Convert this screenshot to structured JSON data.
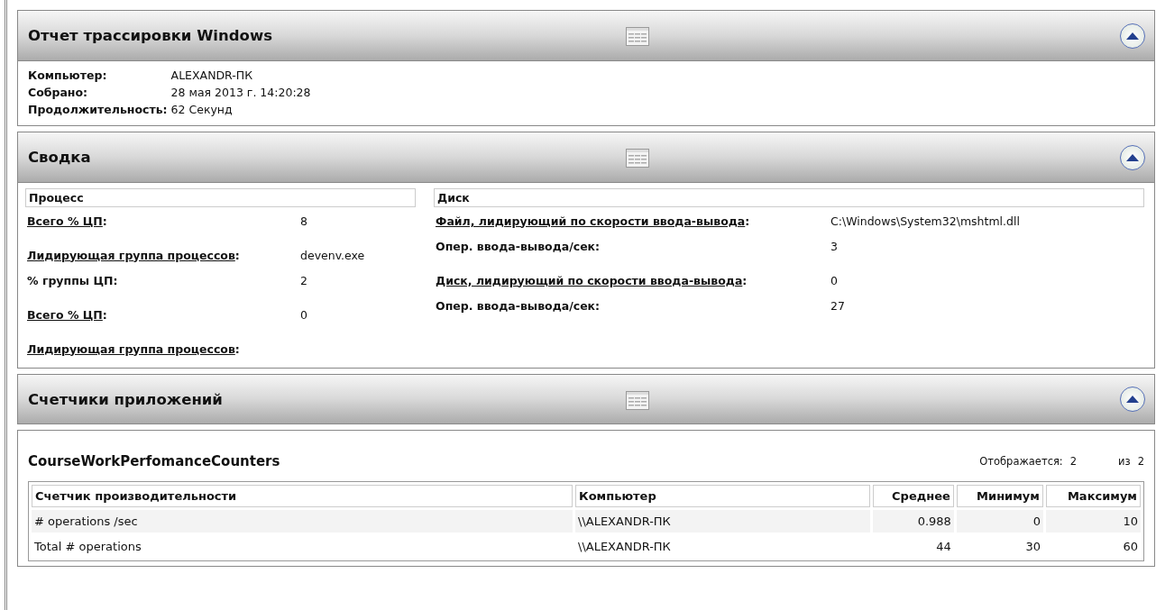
{
  "sections": [
    {
      "title": "Отчет трассировки Windows",
      "kind": "info",
      "info": [
        {
          "label": "Компьютер:",
          "value": "ALEXANDR-ПК"
        },
        {
          "label": "Собрано:",
          "value": "28 мая 2013 г. 14:20:28"
        },
        {
          "label": "Продолжительность:",
          "value": "62 Секунд"
        }
      ]
    },
    {
      "title": "Сводка",
      "kind": "summary",
      "columns": [
        {
          "title": "Процесс",
          "rows": [
            {
              "kind": "link",
              "label": "Всего % ЦП",
              "after": ":",
              "value": "8"
            },
            {
              "kind": "link",
              "label": "Лидирующая группа процессов",
              "after": ":",
              "value": "devenv.exe"
            },
            {
              "kind": "plain",
              "label": "% группы ЦП:",
              "value": "2"
            },
            {
              "kind": "link",
              "label": "Всего % ЦП",
              "after": ":",
              "value": "0"
            },
            {
              "kind": "link",
              "label": "Лидирующая группа процессов",
              "after": ":"
            }
          ]
        },
        {
          "title": "Диск",
          "rows": [
            {
              "kind": "link",
              "label": "Файл, лидирующий по скорости ввода-вывода",
              "after": ":",
              "value": "C:\\Windows\\System32\\mshtml.dll"
            },
            {
              "kind": "plain",
              "label": "Опер. ввода-вывода/сек:",
              "value": "3"
            },
            {
              "kind": "link",
              "label": "Диск, лидирующий по скорости ввода-вывода",
              "after": ":",
              "value": "0"
            },
            {
              "kind": "plain",
              "label": "Опер. ввода-вывода/сек:",
              "value": "27"
            }
          ]
        }
      ]
    },
    {
      "title": "Счетчики приложений",
      "kind": "counters",
      "table_title": "CourseWorkPerfomanceCounters",
      "shown_label": "Отображается:",
      "shown": "2",
      "of_label": "из",
      "total": "2",
      "columns": [
        {
          "label": "Счетчик производительности",
          "kind": "text"
        },
        {
          "label": "Компьютер",
          "kind": "text"
        },
        {
          "label": "Среднее",
          "kind": "number"
        },
        {
          "label": "Минимум",
          "kind": "number"
        },
        {
          "label": "Максимум",
          "kind": "number"
        }
      ],
      "rows": [
        [
          "# operations /sec",
          "\\\\ALEXANDR-ПК",
          "0.988",
          "0",
          "10"
        ],
        [
          "Total # operations",
          "\\\\ALEXANDR-ПК",
          "44",
          "30",
          "60"
        ]
      ]
    }
  ]
}
